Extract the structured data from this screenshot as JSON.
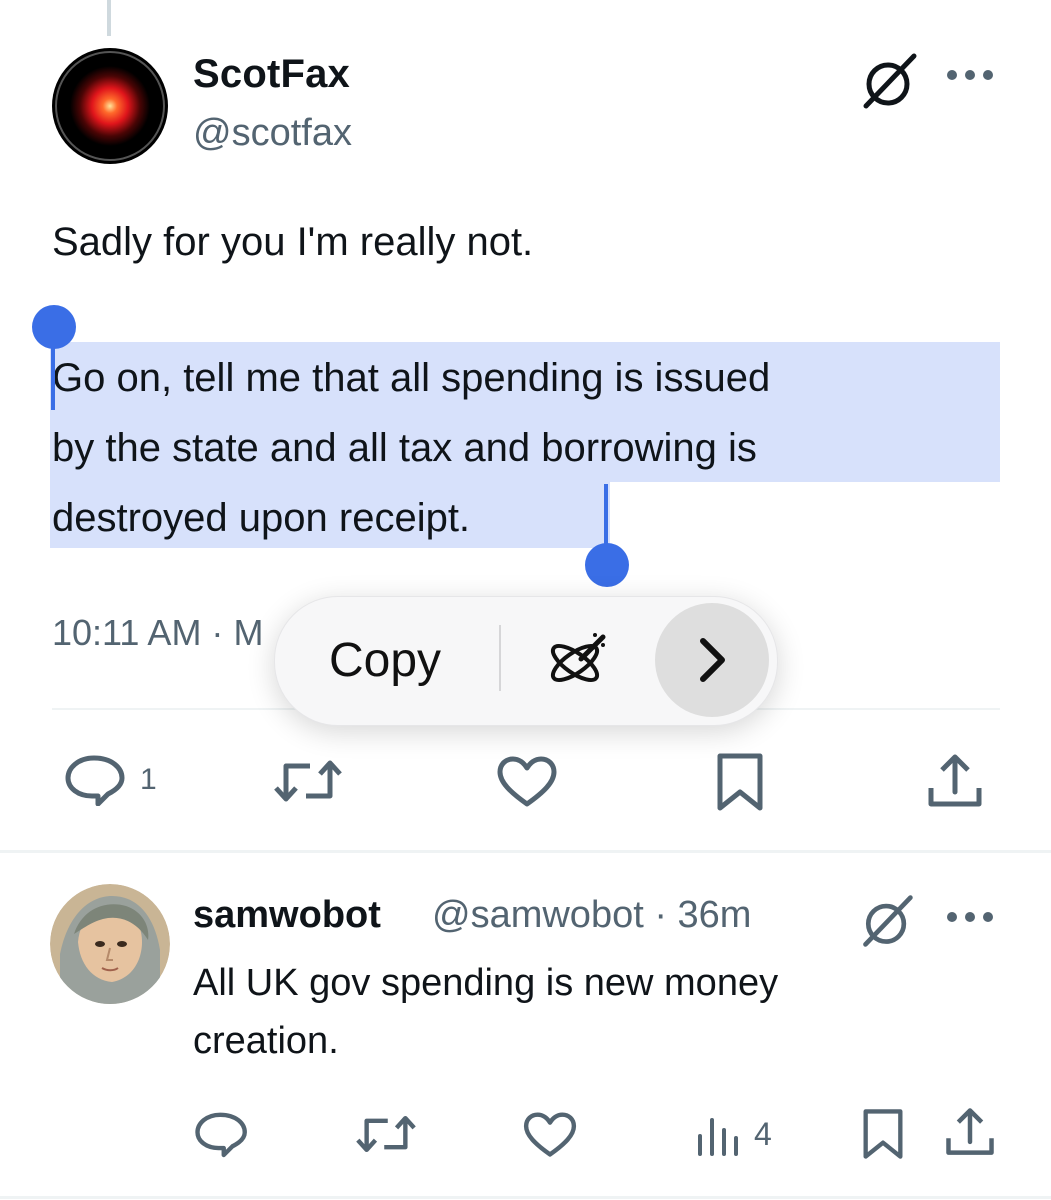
{
  "tweet": {
    "author_name": "ScotFax",
    "author_handle": "@scotfax",
    "line1": "Sadly for you I'm really not.",
    "selected_lines": [
      "Go on, tell me that all spending is issued",
      "by the state and all tax and borrowing is",
      "destroyed upon receipt."
    ],
    "timestamp_visible": "10:11 AM · ",
    "timestamp_clip": "M",
    "reply_count": "1"
  },
  "popup": {
    "copy_label": "Copy"
  },
  "reply": {
    "author_name": "samwobot",
    "author_handle": "@samwobot · 36m",
    "text_lines": [
      "All UK gov spending is new money",
      "creation."
    ],
    "views_count": "4"
  },
  "colors": {
    "selection": "#d7e1fb",
    "handle": "#3a6ee6",
    "muted": "#536471"
  },
  "icons": [
    "grok-icon",
    "more-icon",
    "reply-icon",
    "retweet-icon",
    "like-icon",
    "bookmark-icon",
    "share-icon",
    "views-icon",
    "writing-tools-icon",
    "chevron-right-icon"
  ]
}
